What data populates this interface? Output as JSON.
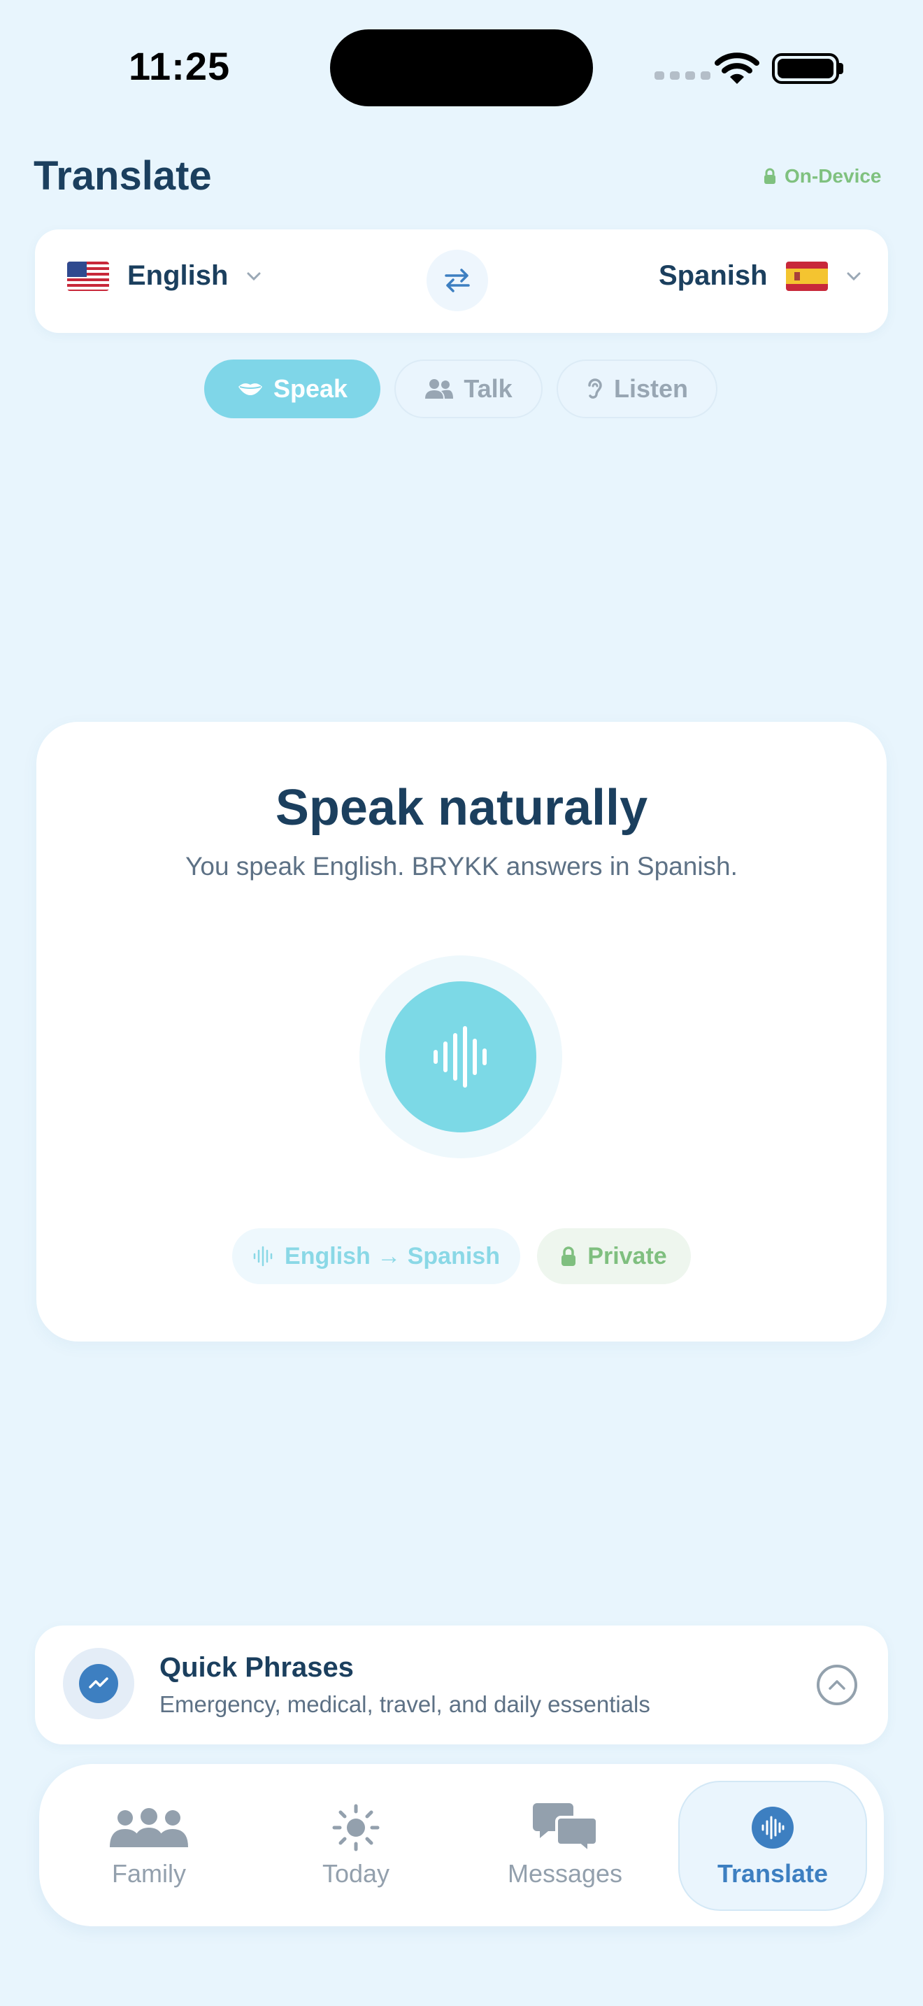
{
  "status": {
    "time": "11:25"
  },
  "header": {
    "title": "Translate",
    "badge": "On-Device"
  },
  "languages": {
    "source": {
      "name": "English",
      "flag": "us-flag"
    },
    "target": {
      "name": "Spanish",
      "flag": "es-flag"
    }
  },
  "modes": [
    {
      "label": "Speak",
      "active": true
    },
    {
      "label": "Talk",
      "active": false
    },
    {
      "label": "Listen",
      "active": false
    }
  ],
  "main": {
    "title": "Speak naturally",
    "subtitle": "You speak English. BRYKK answers in Spanish.",
    "chips": {
      "direction": "English → Spanish",
      "privacy": "Private"
    }
  },
  "quick_phrases": {
    "title": "Quick Phrases",
    "subtitle": "Emergency, medical, travel, and daily essentials"
  },
  "tabs": [
    {
      "label": "Family",
      "icon": "people-icon"
    },
    {
      "label": "Today",
      "icon": "sun-icon"
    },
    {
      "label": "Messages",
      "icon": "chat-bubbles-icon"
    },
    {
      "label": "Translate",
      "icon": "waveform-icon",
      "active": true
    }
  ],
  "colors": {
    "background": "#e8f5fd",
    "accent": "#7cd9e6",
    "primary_text": "#1b3f5e",
    "brand_blue": "#3d7fc1",
    "private_green": "#7fbf7f"
  }
}
